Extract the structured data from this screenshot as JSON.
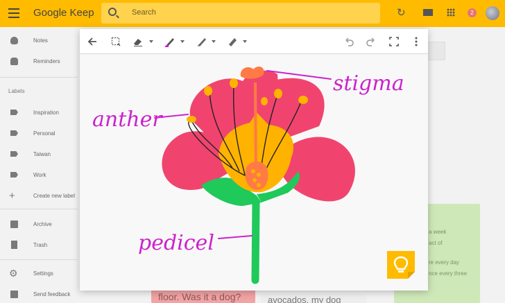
{
  "app": {
    "title": "Google Keep",
    "search_placeholder": "Search",
    "notification_count": "2"
  },
  "sidebar": {
    "top_items": [
      {
        "label": "Notes",
        "icon": "bulb-icon"
      },
      {
        "label": "Reminders",
        "icon": "reminder-hand-icon"
      }
    ],
    "labels_heading": "Labels",
    "label_items": [
      {
        "label": "Inspiration",
        "icon": "label-tag-icon"
      },
      {
        "label": "Personal",
        "icon": "label-tag-icon"
      },
      {
        "label": "Taiwan",
        "icon": "label-tag-icon"
      },
      {
        "label": "Work",
        "icon": "label-tag-icon"
      },
      {
        "label": "Create new label",
        "icon": "plus-icon"
      }
    ],
    "bottom_items": [
      {
        "label": "Archive",
        "icon": "archive-icon"
      },
      {
        "label": "Trash",
        "icon": "trash-icon"
      },
      {
        "label": "Settings",
        "icon": "gear-icon"
      },
      {
        "label": "Send feedback",
        "icon": "feedback-icon"
      }
    ]
  },
  "notes": {
    "green_lines": [
      "a week",
      "act of",
      "re every day",
      "nce every three"
    ],
    "pink_text": "floor. Was it a dog?",
    "white_text": "avocados, my dog"
  },
  "drawing": {
    "toolbar": [
      "back-arrow-icon",
      "select-icon",
      "eraser-icon",
      "marker-icon",
      "pen-icon",
      "highlighter-icon",
      "undo-icon",
      "redo-icon",
      "fullscreen-icon",
      "more-vert-icon"
    ],
    "labels": {
      "anther": "anther",
      "stigma": "stigma",
      "pedicel": "pedicel"
    },
    "colors": {
      "accent": "#ffbb00",
      "petal": "#f0446e",
      "center": "#ffb300",
      "stem": "#1fc95a",
      "ink": "#cc22cc",
      "stigma": "#ff7a45"
    }
  }
}
